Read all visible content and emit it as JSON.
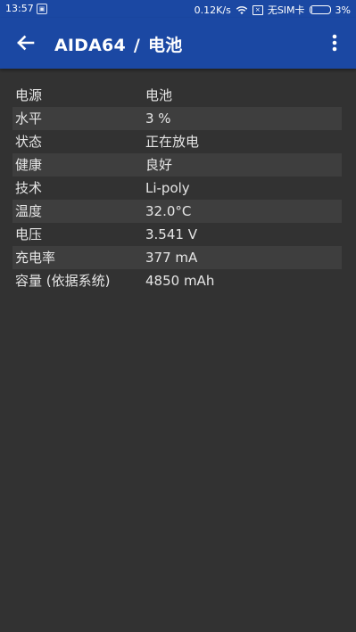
{
  "status_bar": {
    "time": "13:57",
    "notification_icon": "image-icon",
    "network_speed": "0.12K/s",
    "sim_status": "无SIM卡",
    "battery": "3%",
    "battery_level": 0.03
  },
  "toolbar": {
    "app_name": "AIDA64",
    "separator": "/",
    "page_title": "电池",
    "back_icon": "arrow-left-icon",
    "menu_icon": "more-vert-icon"
  },
  "rows": [
    {
      "label": "电源",
      "value": "电池"
    },
    {
      "label": "水平",
      "value": "3 %"
    },
    {
      "label": "状态",
      "value": "正在放电"
    },
    {
      "label": "健康",
      "value": "良好"
    },
    {
      "label": "技术",
      "value": "Li-poly"
    },
    {
      "label": "温度",
      "value": "32.0°C"
    },
    {
      "label": "电压",
      "value": "3.541 V"
    },
    {
      "label": "充电率",
      "value": "377 mA"
    },
    {
      "label": "容量 (依据系统)",
      "value": "4850 mAh"
    }
  ],
  "colors": {
    "toolbar": "#1b48a3",
    "background": "#323232",
    "row_alt": "#3e3e3e",
    "text": "#e6e6e6"
  }
}
